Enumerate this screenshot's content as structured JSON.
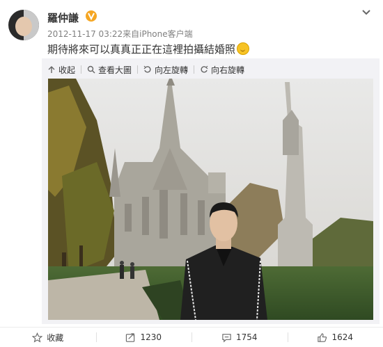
{
  "post": {
    "author": "羅仲謙",
    "meta": "2012-11-17 03:22来自iPhone客户端",
    "text": "期待將來可以真真正正在這裡拍攝結婚照"
  },
  "toolbar": {
    "collapse": "收起",
    "view_large": "查看大圖",
    "rotate_left": "向左旋轉",
    "rotate_right": "向右旋轉"
  },
  "actions": {
    "favorite": "收藏",
    "repost": "1230",
    "comment": "1754",
    "like": "1624"
  },
  "colors": {
    "verified": "#f5a623",
    "link": "#333333",
    "muted": "#808080"
  }
}
